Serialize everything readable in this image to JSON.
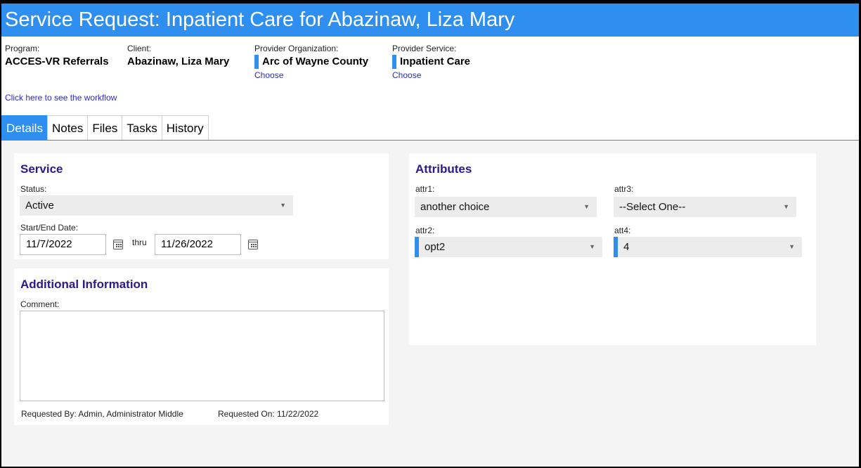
{
  "title": "Service Request: Inpatient Care for Abazinaw, Liza Mary",
  "header": {
    "program": {
      "label": "Program:",
      "value": "ACCES-VR Referrals"
    },
    "client": {
      "label": "Client:",
      "value": "Abazinaw, Liza Mary"
    },
    "provider_org": {
      "label": "Provider Organization:",
      "value": "Arc of Wayne County",
      "choose": "Choose"
    },
    "provider_service": {
      "label": "Provider Service:",
      "value": "Inpatient Care",
      "choose": "Choose"
    },
    "workflow_link": "Click here to see the workflow"
  },
  "tabs": [
    {
      "label": "Details",
      "active": true
    },
    {
      "label": "Notes"
    },
    {
      "label": "Files"
    },
    {
      "label": "Tasks"
    },
    {
      "label": "History"
    }
  ],
  "service": {
    "title": "Service",
    "status_label": "Status:",
    "status_value": "Active",
    "date_label": "Start/End Date:",
    "start_date": "11/7/2022",
    "thru": "thru",
    "end_date": "11/26/2022"
  },
  "additional": {
    "title": "Additional Information",
    "comment_label": "Comment:",
    "comment_value": "",
    "requested_by": "Requested By: Admin, Administrator Middle",
    "requested_on": "Requested On: 11/22/2022"
  },
  "attributes": {
    "title": "Attributes",
    "attr1": {
      "label": "attr1:",
      "value": "another choice"
    },
    "attr2": {
      "label": "attr2:",
      "value": "opt2"
    },
    "attr3": {
      "label": "attr3:",
      "value": "--Select One--"
    },
    "att4": {
      "label": "att4:",
      "value": "4"
    }
  },
  "colors": {
    "accent": "#2e8ff0",
    "heading": "#2a1a8a",
    "link": "#2a2ad0"
  }
}
